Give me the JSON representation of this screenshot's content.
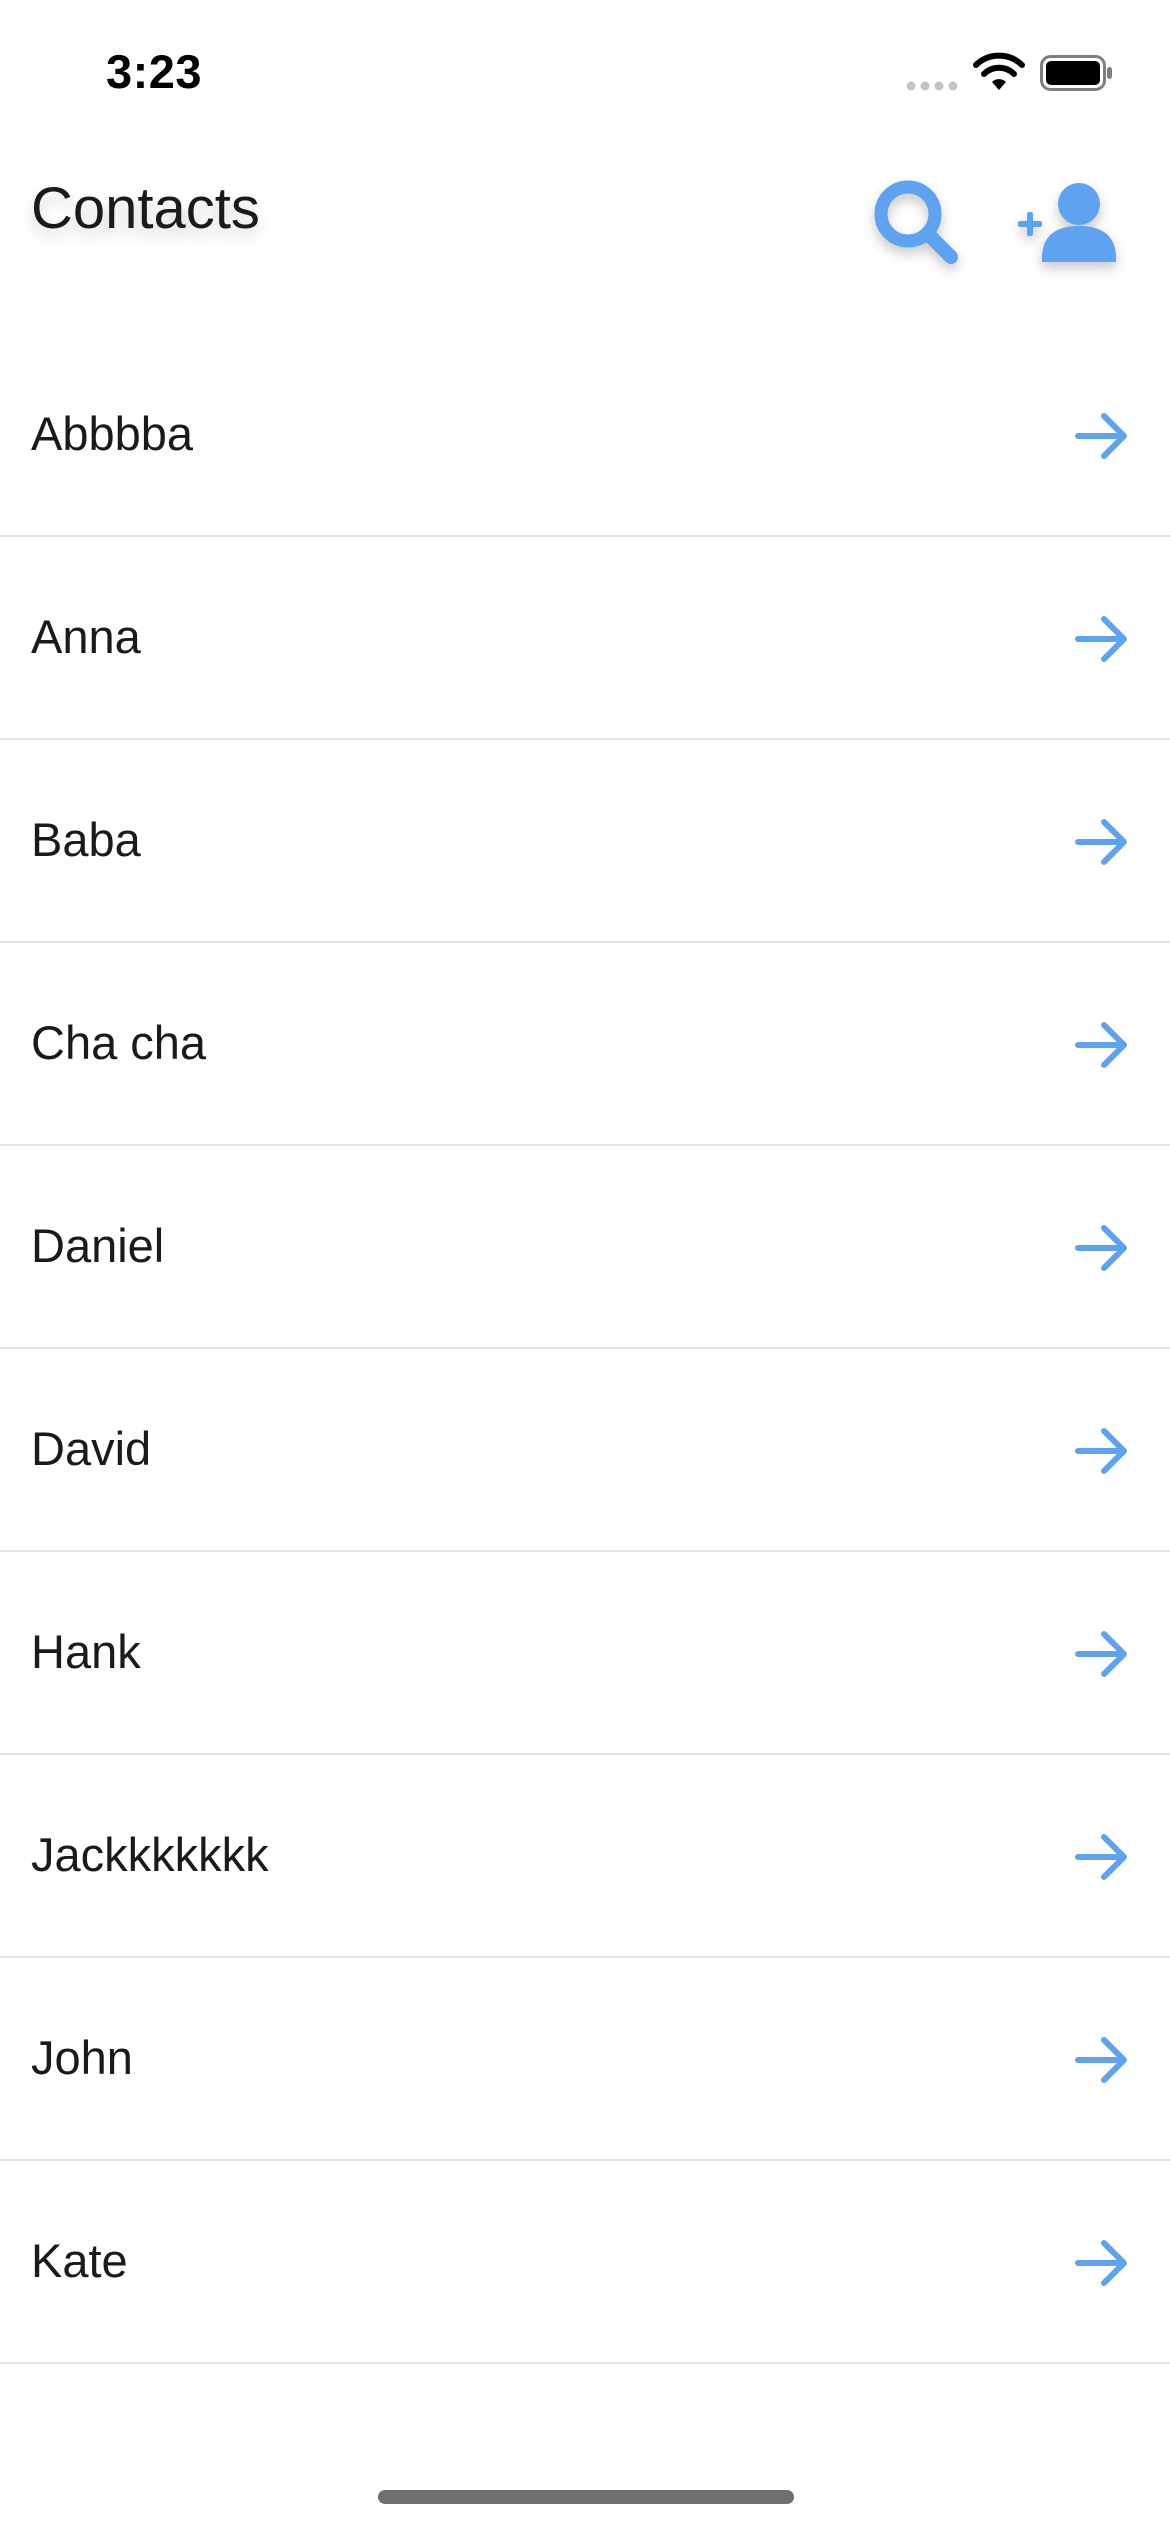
{
  "status_bar": {
    "time": "3:23",
    "signal_icon": "signal-dots-icon",
    "wifi_icon": "wifi-icon",
    "battery_icon": "battery-icon"
  },
  "header": {
    "title": "Contacts",
    "search_icon": "search-icon",
    "add_contact_icon": "add-user-icon"
  },
  "contacts": [
    {
      "name": "Abbbba"
    },
    {
      "name": "Anna"
    },
    {
      "name": "Baba"
    },
    {
      "name": "Cha cha"
    },
    {
      "name": "Daniel"
    },
    {
      "name": "David"
    },
    {
      "name": "Hank"
    },
    {
      "name": "Jackkkkkkk"
    },
    {
      "name": "John"
    },
    {
      "name": "Kate"
    }
  ],
  "row_icon": "arrow-right-icon",
  "colors": {
    "accent": "#5ea2f0",
    "text": "#1a1a1a",
    "divider": "#e2e2e2",
    "background": "#ffffff"
  }
}
